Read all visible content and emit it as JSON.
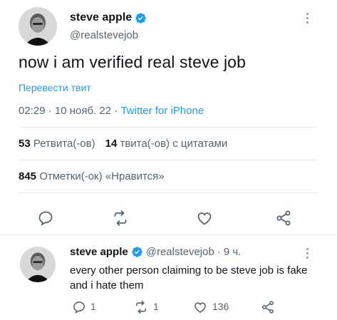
{
  "main_tweet": {
    "display_name": "steve apple",
    "handle": "@realstevejob",
    "text": "now i am verified real steve job",
    "translate_label": "Перевести твит",
    "time": "02:29",
    "date": "10 нояб. 22",
    "source": "Twitter for iPhone",
    "retweets_count": "53",
    "retweets_label": "Ретвита(-ов)",
    "quotes_count": "14",
    "quotes_label": "твита(-ов) с цитатами",
    "likes_count": "845",
    "likes_label": "Отметки(-ок) «Нравится»"
  },
  "reply_tweet": {
    "display_name": "steve apple",
    "handle": "@realstevejob",
    "age": "9 ч.",
    "text": "every other person claiming to be steve job is fake and i hate them",
    "replies": "1",
    "retweets": "1",
    "likes": "136"
  },
  "icons": {
    "verified": "verified-badge-icon",
    "reply": "reply-icon",
    "retweet": "retweet-icon",
    "like": "heart-icon",
    "share": "share-icon",
    "more": "more-dots-icon"
  },
  "colors": {
    "accent": "#1d9bf0",
    "secondary_text": "#536471",
    "icon_gray": "#536471"
  }
}
